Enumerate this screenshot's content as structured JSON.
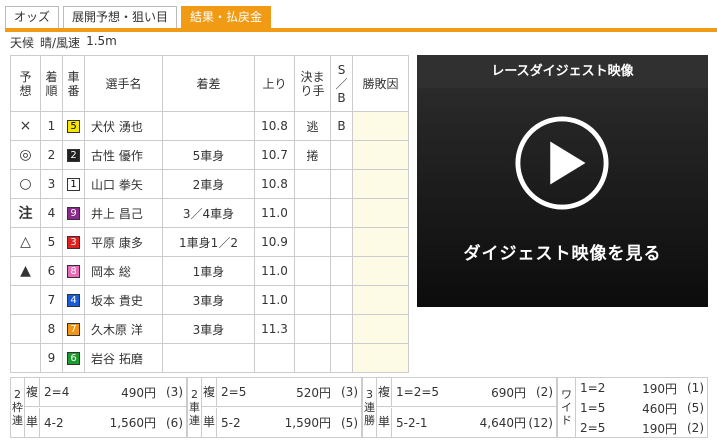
{
  "tabs": [
    "オッズ",
    "展開予想・狙い目",
    "結果・払戻金"
  ],
  "weather": {
    "label": "天候",
    "value": "晴/風速",
    "speed": "1.5m"
  },
  "results": {
    "headers": {
      "yosou": [
        "予",
        "想"
      ],
      "chakujun": [
        "着",
        "順"
      ],
      "shaban": [
        "車",
        "番"
      ],
      "name": "選手名",
      "chakusa": "着差",
      "agari": "上り",
      "kimarite": [
        "決ま",
        "り手"
      ],
      "sb": [
        "S",
        "／",
        "B"
      ],
      "factor": "勝敗因"
    },
    "rows": [
      {
        "mark": "×",
        "pos": "1",
        "car": "5",
        "name": "犬伏 湧也",
        "margin": "",
        "agari": "10.8",
        "kimarite": "逃",
        "sb": "B"
      },
      {
        "mark": "◎",
        "pos": "2",
        "car": "2",
        "name": "古性 優作",
        "margin": "5車身",
        "agari": "10.7",
        "kimarite": "捲",
        "sb": ""
      },
      {
        "mark": "○",
        "pos": "3",
        "car": "1",
        "name": "山口 拳矢",
        "margin": "2車身",
        "agari": "10.8",
        "kimarite": "",
        "sb": ""
      },
      {
        "mark": "注",
        "pos": "4",
        "car": "9",
        "name": "井上 昌己",
        "margin": "3／4車身",
        "agari": "11.0",
        "kimarite": "",
        "sb": ""
      },
      {
        "mark": "△",
        "pos": "5",
        "car": "3",
        "name": "平原 康多",
        "margin": "1車身1／2",
        "agari": "10.9",
        "kimarite": "",
        "sb": ""
      },
      {
        "mark": "▲",
        "pos": "6",
        "car": "8",
        "name": "岡本 総",
        "margin": "1車身",
        "agari": "11.0",
        "kimarite": "",
        "sb": ""
      },
      {
        "mark": "",
        "pos": "7",
        "car": "4",
        "name": "坂本 貴史",
        "margin": "3車身",
        "agari": "11.0",
        "kimarite": "",
        "sb": ""
      },
      {
        "mark": "",
        "pos": "8",
        "car": "7",
        "name": "久木原 洋",
        "margin": "3車身",
        "agari": "11.3",
        "kimarite": "",
        "sb": ""
      },
      {
        "mark": "",
        "pos": "9",
        "car": "6",
        "name": "岩谷 拓磨",
        "margin": "",
        "agari": "",
        "kimarite": "",
        "sb": ""
      }
    ]
  },
  "car_colors": {
    "1": {
      "bg": "#ffffff",
      "fg": "#000000"
    },
    "2": {
      "bg": "#222222",
      "fg": "#ffffff"
    },
    "3": {
      "bg": "#e0201f",
      "fg": "#ffffff"
    },
    "4": {
      "bg": "#1a5bd6",
      "fg": "#ffffff"
    },
    "5": {
      "bg": "#f5e500",
      "fg": "#000000"
    },
    "6": {
      "bg": "#1e9b2e",
      "fg": "#ffffff"
    },
    "7": {
      "bg": "#f29514",
      "fg": "#ffffff"
    },
    "8": {
      "bg": "#e96ab5",
      "fg": "#ffffff"
    },
    "9": {
      "bg": "#8a2a8a",
      "fg": "#ffffff"
    }
  },
  "video": {
    "title": "レースダイジェスト映像",
    "cta": "ダイジェスト映像を見る"
  },
  "payout": {
    "wakutan": {
      "label": [
        "2",
        "枠",
        "連"
      ],
      "fuku": {
        "kind": "複",
        "combo": "2=4",
        "amount": "490円",
        "pop": "(3)"
      },
      "tan": {
        "kind": "単",
        "combo": "4-2",
        "amount": "1,560円",
        "pop": "(6)"
      }
    },
    "nishatan": {
      "label": [
        "2",
        "車",
        "連"
      ],
      "fuku": {
        "kind": "複",
        "combo": "2=5",
        "amount": "520円",
        "pop": "(3)"
      },
      "tan": {
        "kind": "単",
        "combo": "5-2",
        "amount": "1,590円",
        "pop": "(5)"
      }
    },
    "sanrentan": {
      "label": [
        "3",
        "連",
        "勝"
      ],
      "fuku": {
        "kind": "複",
        "combo": "1=2=5",
        "amount": "690円",
        "pop": "(2)"
      },
      "tan": {
        "kind": "単",
        "combo": "5-2-1",
        "amount": "4,640円",
        "pop": "(12)"
      }
    },
    "wide": {
      "label": [
        "ワ",
        "イ",
        "ド"
      ],
      "rows": [
        {
          "combo": "1=2",
          "amount": "190円",
          "pop": "(1)"
        },
        {
          "combo": "1=5",
          "amount": "460円",
          "pop": "(5)"
        },
        {
          "combo": "2=5",
          "amount": "190円",
          "pop": "(2)"
        }
      ]
    }
  }
}
